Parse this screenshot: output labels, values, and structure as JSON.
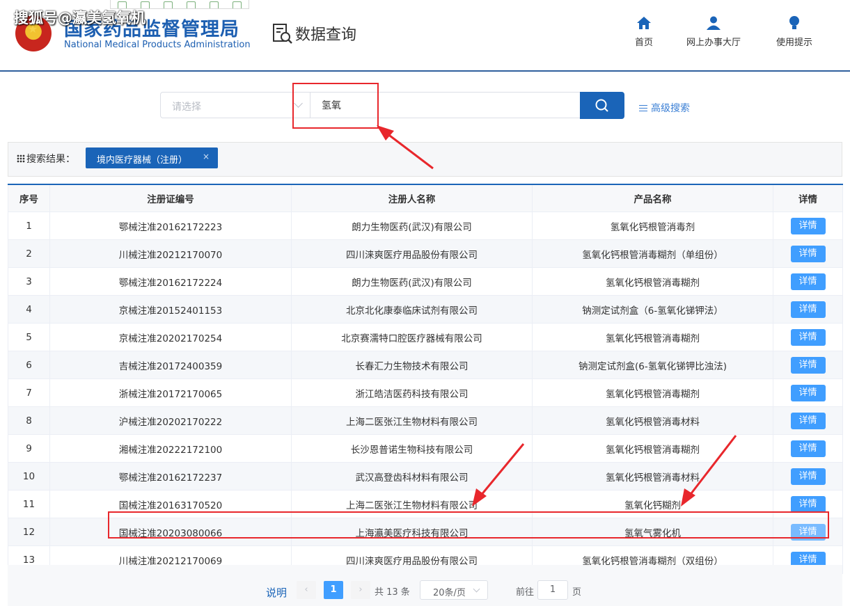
{
  "watermark": "搜狐号@瀛美氢氧机",
  "org": {
    "name_cn": "国家药品监督管理局",
    "name_en": "National Medical Products Administration"
  },
  "page_title": "数据查询",
  "nav": [
    {
      "label": "首页",
      "icon": "home-icon"
    },
    {
      "label": "网上办事大厅",
      "icon": "user-icon"
    },
    {
      "label": "使用提示",
      "icon": "bulb-icon"
    }
  ],
  "search": {
    "select_placeholder": "请选择",
    "query": "氢氧",
    "advanced_label": "高级搜索"
  },
  "result": {
    "label": "搜索结果：",
    "tag": "境内医疗器械（注册）",
    "tag_close": "×"
  },
  "table": {
    "headers": [
      "序号",
      "注册证编号",
      "注册人名称",
      "产品名称",
      "详情"
    ],
    "detail_label": "详情",
    "rows": [
      [
        "1",
        "鄂械注准20162172223",
        "朗力生物医药(武汉)有限公司",
        "氢氧化钙根管消毒剂"
      ],
      [
        "2",
        "川械注准20212170070",
        "四川涞爽医疗用品股份有限公司",
        "氢氧化钙根管消毒糊剂（单组份）"
      ],
      [
        "3",
        "鄂械注准20162172224",
        "朗力生物医药(武汉)有限公司",
        "氢氧化钙根管消毒糊剂"
      ],
      [
        "4",
        "京械注准20152401153",
        "北京北化康泰临床试剂有限公司",
        "钠测定试剂盒（6-氢氧化锑钾法）"
      ],
      [
        "5",
        "京械注准20202170254",
        "北京赛濡特口腔医疗器械有限公司",
        "氢氧化钙根管消毒糊剂"
      ],
      [
        "6",
        "吉械注准20172400359",
        "长春汇力生物技术有限公司",
        "钠测定试剂盒(6-氢氧化锑钾比浊法)"
      ],
      [
        "7",
        "浙械注准20172170065",
        "浙江皓洁医药科技有限公司",
        "氢氧化钙根管消毒糊剂"
      ],
      [
        "8",
        "沪械注准20202170222",
        "上海二医张江生物材料有限公司",
        "氢氧化钙根管消毒材料"
      ],
      [
        "9",
        "湘械注准20222172100",
        "长沙恩普诺生物科技有限公司",
        "氢氧化钙根管消毒糊剂"
      ],
      [
        "10",
        "鄂械注准20162172237",
        "武汉高登齿科材料有限公司",
        "氢氧化钙根管消毒材料"
      ],
      [
        "11",
        "国械注准20163170520",
        "上海二医张江生物材料有限公司",
        "氢氧化钙糊剂"
      ],
      [
        "12",
        "国械注准20203080066",
        "上海瀛美医疗科技有限公司",
        "氢氧气雾化机"
      ],
      [
        "13",
        "川械注准20212170069",
        "四川涞爽医疗用品股份有限公司",
        "氢氧化钙根管消毒糊剂（双组份）"
      ]
    ]
  },
  "pagination": {
    "explain": "说明",
    "current_page": "1",
    "total": "共 13 条",
    "page_size": "20条/页",
    "goto_label": "前往",
    "goto_value": "1",
    "page_unit": "页"
  },
  "colors": {
    "primary": "#1a64b8",
    "detail_button": "#409eff",
    "annotation_red": "#e8272c"
  }
}
